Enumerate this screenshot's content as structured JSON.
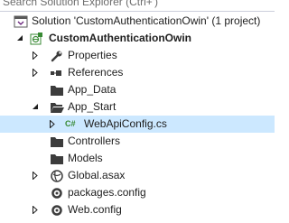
{
  "search": {
    "placeholder": "Search Solution Explorer (Ctrl+')"
  },
  "tree": {
    "solution": {
      "label": "Solution 'CustomAuthenticationOwin' (1 project)"
    },
    "project": {
      "label": "CustomAuthenticationOwin"
    },
    "properties": {
      "label": "Properties"
    },
    "references": {
      "label": "References"
    },
    "app_data": {
      "label": "App_Data"
    },
    "app_start": {
      "label": "App_Start"
    },
    "webapiconfig": {
      "label": "WebApiConfig.cs",
      "icon_text": "C#"
    },
    "controllers": {
      "label": "Controllers"
    },
    "models": {
      "label": "Models"
    },
    "global": {
      "label": "Global.asax"
    },
    "packages": {
      "label": "packages.config"
    },
    "webconfig": {
      "label": "Web.config"
    }
  },
  "colors": {
    "selection": "#cce8ff",
    "folder": "#3c3c3c",
    "csharp": "#388a34",
    "project_icon": "#388a34"
  }
}
